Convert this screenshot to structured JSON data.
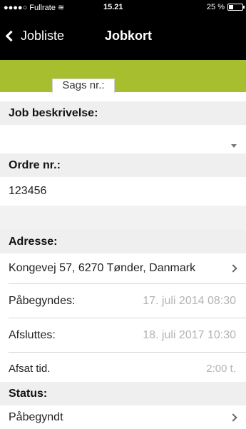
{
  "status_bar": {
    "carrier": "Fullrate",
    "time": "15.21",
    "battery": "25 %"
  },
  "nav": {
    "back_label": "Jobliste",
    "title": "Jobkort"
  },
  "segment": {
    "label": "Sags nr.:"
  },
  "sections": {
    "job_description": "Job beskrivelse:",
    "order_no": "Ordre nr.:",
    "address": "Adresse:",
    "status": "Status:"
  },
  "fields": {
    "job_description": "",
    "order_no": "123456",
    "address": "Kongevej 57, 6270 Tønder, Danmark",
    "start_label": "Påbegyndes:",
    "start_value": "17. juli 2014 08:30",
    "end_label": "Afsluttes:",
    "end_value": "18. juli 2017 10:30",
    "time_label": "Afsat tid.",
    "time_value": "2:00 t.",
    "status_value": "Påbegyndt"
  },
  "colors": {
    "accent": "#a7bf2e",
    "nav_bg": "#000000",
    "section_bg": "#efefef"
  }
}
